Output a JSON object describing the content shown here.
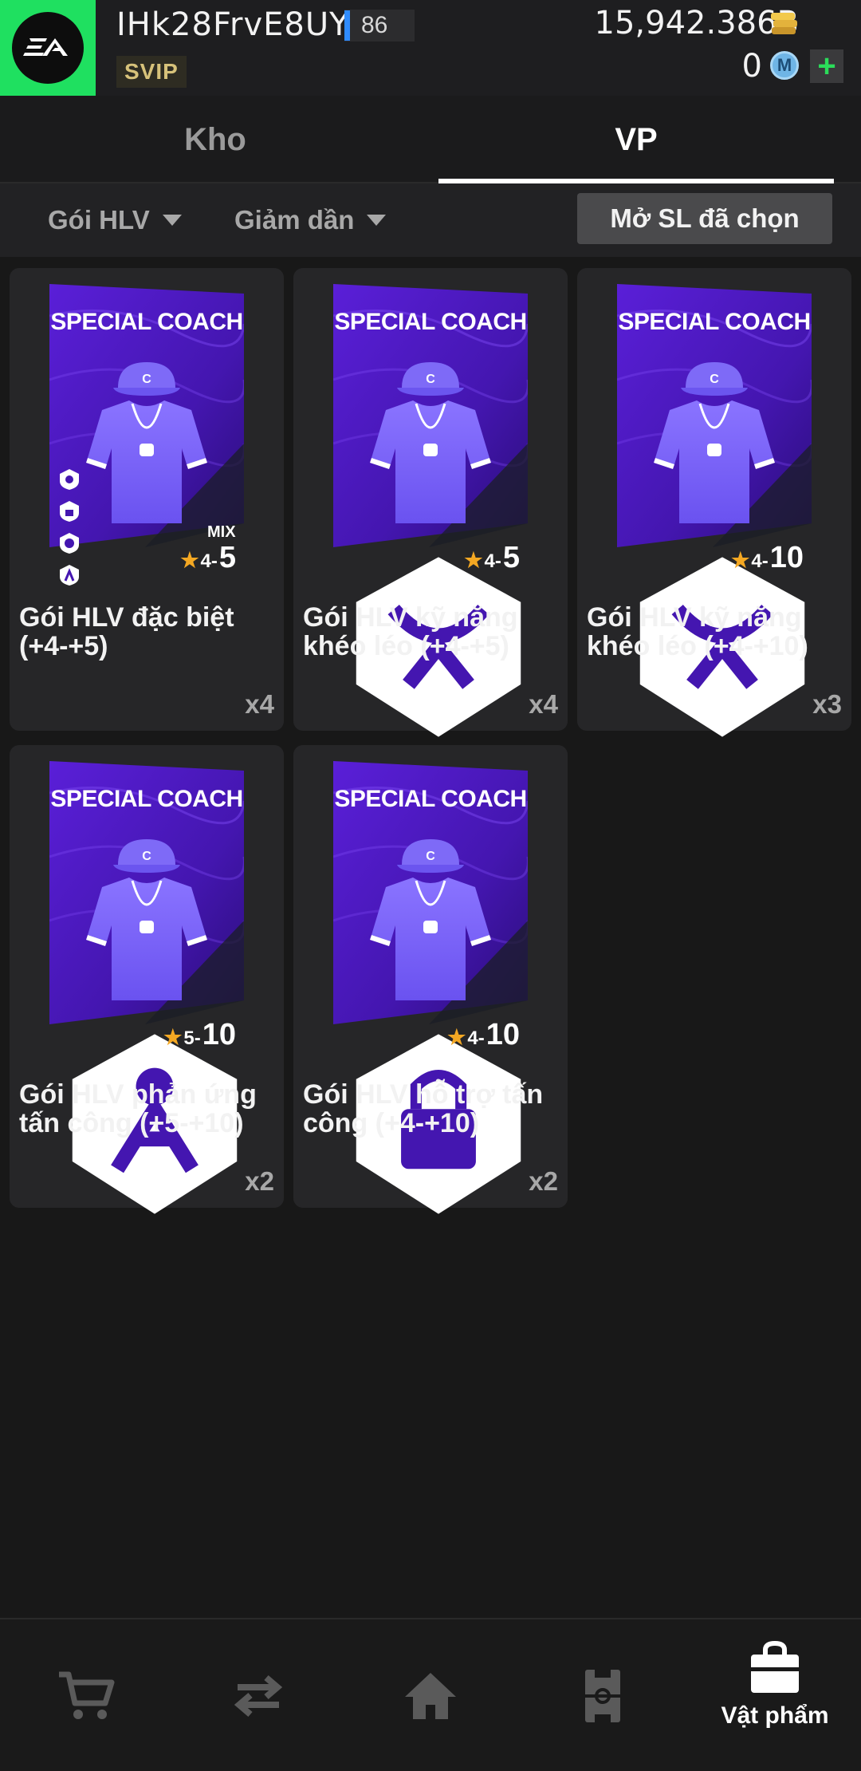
{
  "header": {
    "logo_text": "EA",
    "username": "IHk28FrvE8UYr",
    "level": "86",
    "vip": "SVIP",
    "coins": "15,942.386B",
    "m_count": "0",
    "m_label": "M",
    "plus_label": "+",
    "colors": {
      "logo_bg": "#1fe060",
      "level_bar": "#2f8cff",
      "plus": "#2bdc5a"
    }
  },
  "tabs": [
    {
      "label": "Kho",
      "active": false
    },
    {
      "label": "VP",
      "active": true
    }
  ],
  "filters": {
    "type": "Gói HLV",
    "sort": "Giảm dần",
    "open_selected": "Mở SL đã chọn"
  },
  "items": [
    {
      "card_title": "SPECIAL COACH",
      "mix": "MIX",
      "star": "★",
      "low": "4-",
      "high": "5",
      "name": "Gói HLV đặc biệt (+4-+5)",
      "qty": "x4",
      "icon": "multi-skill-icons"
    },
    {
      "card_title": "SPECIAL COACH",
      "star": "★",
      "low": "4-",
      "high": "5",
      "name": "Gói HLV kỹ năng khéo léo (+4-+5)",
      "qty": "x4",
      "icon": "dribble-skill-icon"
    },
    {
      "card_title": "SPECIAL COACH",
      "star": "★",
      "low": "4-",
      "high": "10",
      "name": "Gói HLV kỹ năng khéo léo (+4-+10)",
      "qty": "x3",
      "icon": "dribble-skill-icon"
    },
    {
      "card_title": "SPECIAL COACH",
      "star": "★",
      "low": "5-",
      "high": "10",
      "name": "Gói HLV phản ứng tấn công (+5-+10)",
      "qty": "x2",
      "icon": "attack-reaction-icon"
    },
    {
      "card_title": "SPECIAL COACH",
      "star": "★",
      "low": "4-",
      "high": "10",
      "name": "Gói HLV hỗ trợ tấn công (+4-+10)",
      "qty": "x2",
      "icon": "attack-support-icon"
    }
  ],
  "nav": [
    {
      "icon": "cart-icon",
      "label": ""
    },
    {
      "icon": "transfer-icon",
      "label": ""
    },
    {
      "icon": "home-icon",
      "label": ""
    },
    {
      "icon": "pitch-icon",
      "label": ""
    },
    {
      "icon": "bag-icon",
      "label": "Vật phẩm",
      "active": true
    }
  ]
}
